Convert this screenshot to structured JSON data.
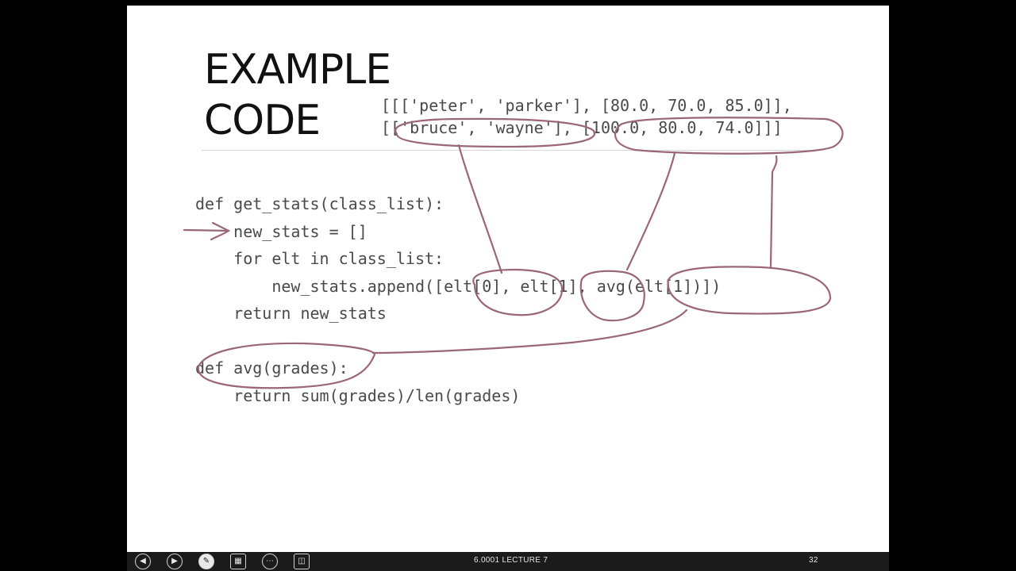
{
  "slide": {
    "title_lines": [
      "EXAMPLE",
      "CODE"
    ],
    "data_lines": [
      "[[['peter', 'parker'], [80.0, 70.0, 85.0]],",
      "[['bruce', 'wayne'], [100.0, 80.0, 74.0]]]"
    ],
    "code_lines": [
      "def get_stats(class_list):",
      "    new_stats = []",
      "    for elt in class_list:",
      "        new_stats.append([elt[0], elt[1], avg(elt[1])])",
      "    return new_stats",
      "def avg(grades):",
      "    return sum(grades)/len(grades)"
    ],
    "ink_color": "#9a6678"
  },
  "toolbar": {
    "footer_text": "6.0001 LECTURE 7",
    "page_number": "32",
    "buttons": [
      "previous-icon",
      "next-icon",
      "pen-icon",
      "slides-icon",
      "more-icon",
      "screen-icon"
    ]
  }
}
